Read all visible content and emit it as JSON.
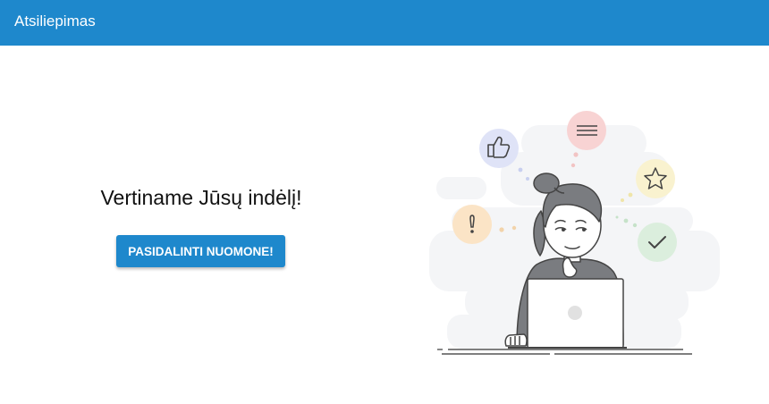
{
  "header": {
    "title": "Atsiliepimas"
  },
  "main": {
    "heading": "Vertiname Jūsų indėlį!",
    "cta_label": "PASIDALINTI NUOMONE!"
  },
  "illustration": {
    "icons": [
      "thumbs-up-icon",
      "menu-lines-icon",
      "star-icon",
      "exclamation-icon",
      "check-icon"
    ]
  },
  "colors": {
    "header_bg": "#1e88cc",
    "button_bg": "#1e88cc",
    "background": "#ffffff",
    "text": "#111111"
  }
}
